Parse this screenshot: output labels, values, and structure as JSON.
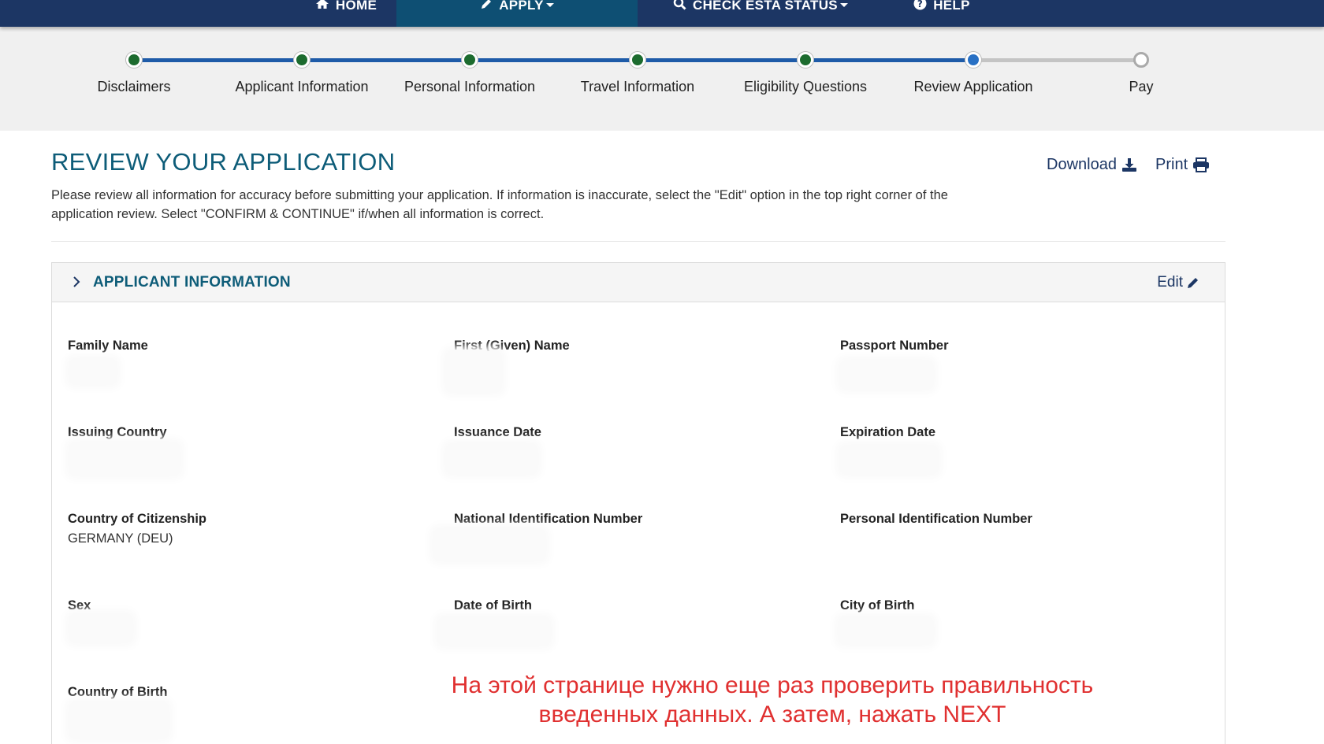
{
  "nav": {
    "home": "HOME",
    "apply": "APPLY",
    "check_status": "CHECK ESTA STATUS",
    "help": "HELP"
  },
  "stepper": {
    "steps": [
      {
        "label": "Disclaimers",
        "state": "complete"
      },
      {
        "label": "Applicant Information",
        "state": "complete"
      },
      {
        "label": "Personal Information",
        "state": "complete"
      },
      {
        "label": "Travel Information",
        "state": "complete"
      },
      {
        "label": "Eligibility Questions",
        "state": "complete"
      },
      {
        "label": "Review Application",
        "state": "current"
      },
      {
        "label": "Pay",
        "state": "upcoming"
      }
    ]
  },
  "page": {
    "title": "REVIEW YOUR APPLICATION",
    "intro": "Please review all information for accuracy before submitting your application. If information is inaccurate, select the \"Edit\" option in the top right corner of the application review. Select \"CONFIRM & CONTINUE\" if/when all information is correct.",
    "download_label": "Download",
    "print_label": "Print"
  },
  "panel": {
    "title": "APPLICANT INFORMATION",
    "edit_label": "Edit",
    "fields": {
      "family_name": {
        "label": "Family Name",
        "value": ""
      },
      "first_name": {
        "label": "First (Given) Name",
        "value": ""
      },
      "passport_number": {
        "label": "Passport Number",
        "value": ""
      },
      "issuing_country": {
        "label": "Issuing Country",
        "value": ""
      },
      "issuance_date": {
        "label": "Issuance Date",
        "value": ""
      },
      "expiration_date": {
        "label": "Expiration Date",
        "value": ""
      },
      "citizenship": {
        "label": "Country of Citizenship",
        "value": "GERMANY (DEU)"
      },
      "national_id": {
        "label": "National Identification Number",
        "value": ""
      },
      "personal_id": {
        "label": "Personal Identification Number",
        "value": ""
      },
      "sex": {
        "label": "Sex",
        "value": ""
      },
      "dob": {
        "label": "Date of Birth",
        "value": ""
      },
      "city_of_birth": {
        "label": "City of Birth",
        "value": ""
      },
      "country_of_birth": {
        "label": "Country of Birth",
        "value": ""
      }
    }
  },
  "annotation": {
    "line1": "На этой странице нужно еще раз проверить правильность",
    "line2": "введенных данных.  А затем, нажать NEXT"
  },
  "colors": {
    "nav_bg": "#1c3664",
    "nav_active": "#0e4f73",
    "title": "#0d5c78",
    "step_complete": "#1c6b2e",
    "step_current": "#2870c4",
    "annotation": "#e03030"
  },
  "icons": {
    "home": "home-icon",
    "apply": "pencil-icon",
    "check": "search-icon",
    "help": "question-circle-icon",
    "download": "download-icon",
    "print": "printer-icon",
    "edit": "pencil-icon",
    "expand": "chevron-right-icon"
  }
}
